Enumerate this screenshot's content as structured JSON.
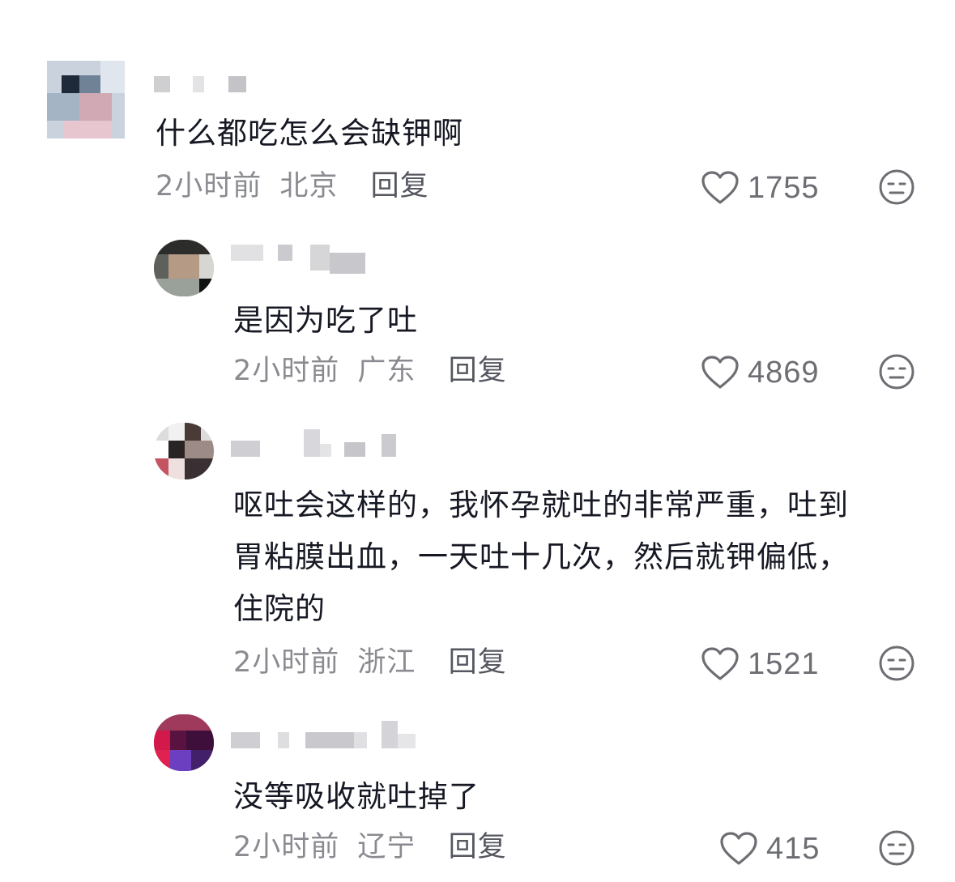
{
  "comments": [
    {
      "text": "什么都吃怎么会缺钾啊",
      "time": "2小时前",
      "location": "北京",
      "reply_label": "回复",
      "likes": "1755",
      "level": 0
    },
    {
      "text": "是因为吃了吐",
      "time": "2小时前",
      "location": "广东",
      "reply_label": "回复",
      "likes": "4869",
      "level": 1
    },
    {
      "text": "呕吐会这样的，我怀孕就吐的非常严重，吐到\n胃粘膜出血，一天吐十几次，然后就钾偏低，\n住院的",
      "time": "2小时前",
      "location": "浙江",
      "reply_label": "回复",
      "likes": "1521",
      "level": 1
    },
    {
      "text": "没等吸收就吐掉了",
      "time": "2小时前",
      "location": "辽宁",
      "reply_label": "回复",
      "likes": "415",
      "level": 1
    }
  ],
  "icons": {
    "like": "heart-outline-icon",
    "dislike": "neutral-face-icon"
  },
  "colors": {
    "text": "#161823",
    "meta": "#8a8b91",
    "icon": "#6d6e73"
  }
}
